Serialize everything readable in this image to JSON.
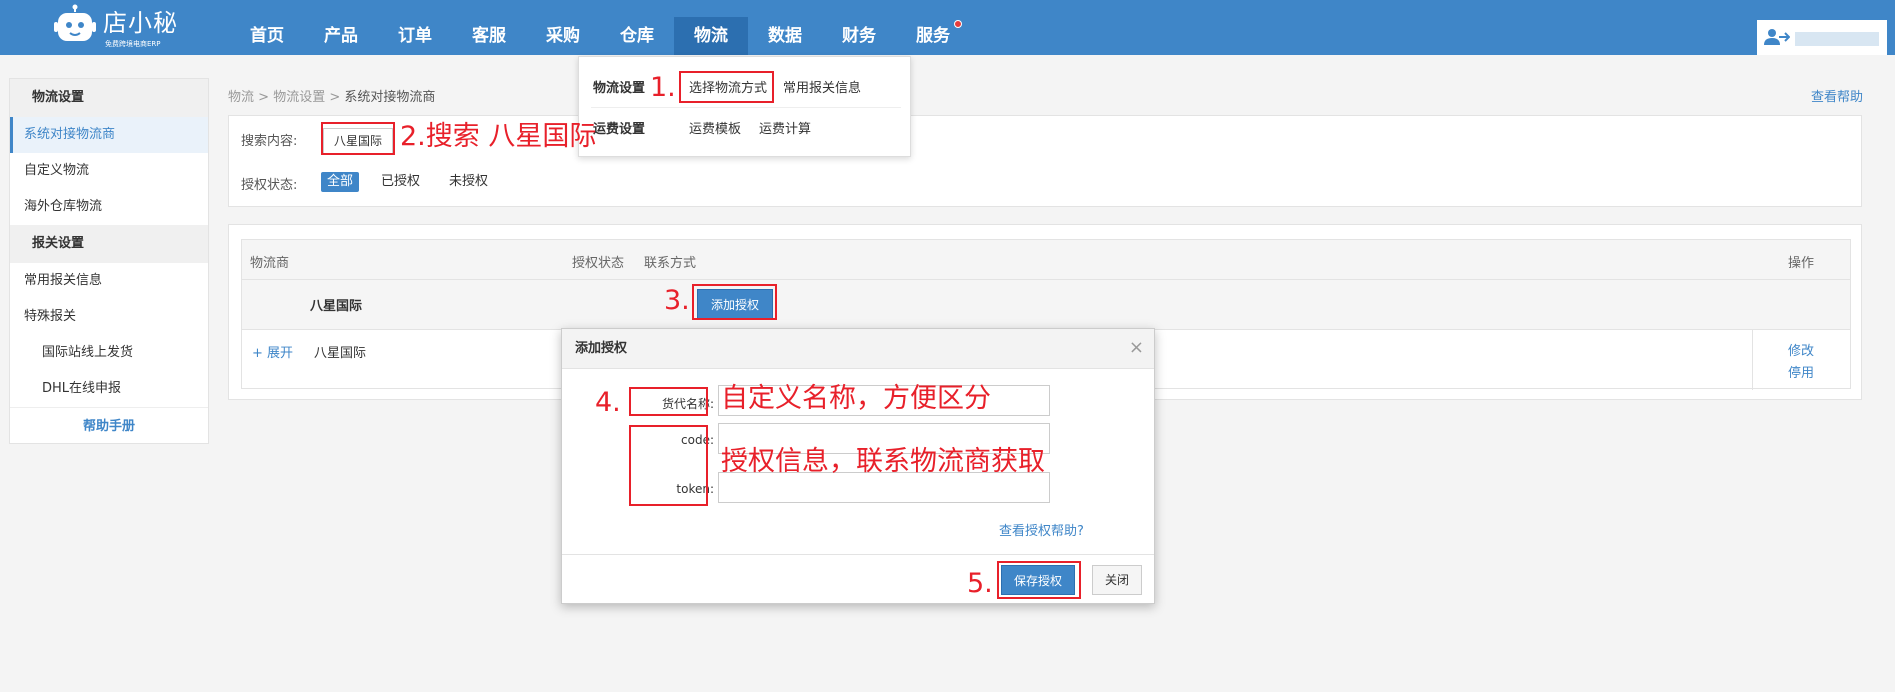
{
  "app": {
    "logo_text": "店小秘",
    "logo_sub": "免费跨境电商ERP"
  },
  "nav": {
    "items": [
      "首页",
      "产品",
      "订单",
      "客服",
      "采购",
      "仓库",
      "物流",
      "数据",
      "财务",
      "服务"
    ],
    "active": "物流"
  },
  "sidebar": {
    "group1": "物流设置",
    "item_system": "系统对接物流商",
    "item_custom": "自定义物流",
    "item_overseas": "海外仓库物流",
    "group2": "报关设置",
    "item_customs_info": "常用报关信息",
    "item_special": "特殊报关",
    "item_intl": "国际站线上发货",
    "item_dhl": "DHL在线申报",
    "help": "帮助手册"
  },
  "breadcrumb": {
    "level1": "物流",
    "sep": ">",
    "level2": "物流设置",
    "current": "系统对接物流商"
  },
  "help_link": "查看帮助",
  "dropdown": {
    "head1": "物流设置",
    "link_select": "选择物流方式",
    "link_customs": "常用报关信息",
    "head2": "运费设置",
    "link_template": "运费模板",
    "link_calc": "运费计算"
  },
  "search": {
    "label": "搜索内容:",
    "value": "八星国际",
    "auth_label": "授权状态:",
    "filters": [
      "全部",
      "已授权",
      "未授权"
    ]
  },
  "table": {
    "headers": {
      "carrier": "物流商",
      "auth_status": "授权状态",
      "contact": "联系方式",
      "ops": "操作"
    },
    "group_name": "八星国际",
    "add_auth_button": "添加授权",
    "row": {
      "expand": "+ 展开",
      "carrier": "八星国际",
      "edit": "修改",
      "disable": "停用"
    }
  },
  "modal": {
    "title": "添加授权",
    "close_glyph": "×",
    "label_name": "货代名称:",
    "label_code": "code:",
    "label_token": "token:",
    "help_auth": "查看授权帮助?",
    "save_button": "保存授权",
    "close_button": "关闭"
  },
  "annotations": {
    "step1": "1.",
    "step2": "2.搜索 八星国际",
    "step3": "3.",
    "step4": "4.",
    "step4_name": "自定义名称，方便区分",
    "step4_auth": "授权信息，联系物流商获取",
    "step5": "5."
  },
  "colors": {
    "brand": "#3f86c8",
    "annotation": "#e8202a"
  }
}
